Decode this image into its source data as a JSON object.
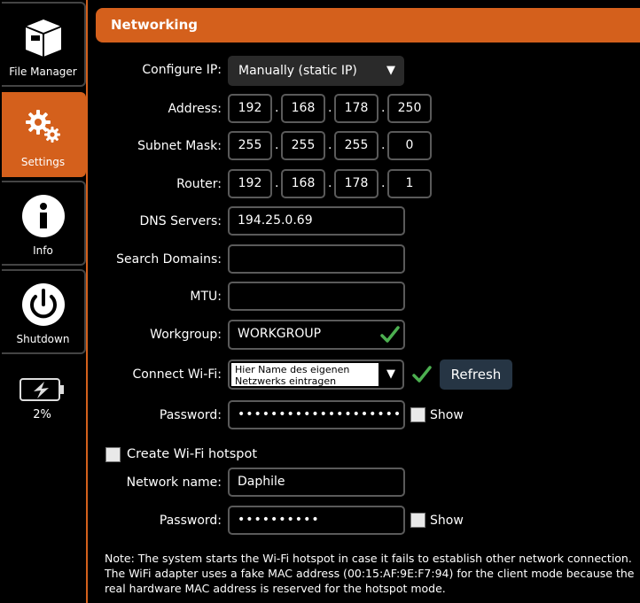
{
  "sidebar": {
    "items": [
      {
        "label": "File Manager",
        "icon": "file-manager-icon",
        "active": false
      },
      {
        "label": "Settings",
        "icon": "gear-icon",
        "active": true
      },
      {
        "label": "Info",
        "icon": "info-icon",
        "active": false
      },
      {
        "label": "Shutdown",
        "icon": "power-icon",
        "active": false
      }
    ],
    "battery": {
      "percent": "2%",
      "icon": "battery-charging-icon"
    }
  },
  "header": {
    "title": "Networking"
  },
  "form": {
    "configure_ip": {
      "label": "Configure IP:",
      "value": "Manually (static IP)"
    },
    "address": {
      "label": "Address:",
      "octets": [
        "192",
        "168",
        "178",
        "250"
      ]
    },
    "subnet_mask": {
      "label": "Subnet Mask:",
      "octets": [
        "255",
        "255",
        "255",
        "0"
      ]
    },
    "router": {
      "label": "Router:",
      "octets": [
        "192",
        "168",
        "178",
        "1"
      ]
    },
    "dns": {
      "label": "DNS Servers:",
      "value": "194.25.0.69"
    },
    "search_domains": {
      "label": "Search Domains:",
      "value": ""
    },
    "mtu": {
      "label": "MTU:",
      "value": ""
    },
    "workgroup": {
      "label": "Workgroup:",
      "value": "WORKGROUP"
    },
    "wifi": {
      "label": "Connect Wi-Fi:",
      "value": "Hier Name des eigenen Netzwerks eintragen",
      "refresh_label": "Refresh"
    },
    "wifi_password": {
      "label": "Password:",
      "value": "••••••••••••••••••••",
      "show_label": "Show"
    },
    "hotspot": {
      "label": "Create Wi-Fi hotspot",
      "checked": false
    },
    "network_name": {
      "label": "Network name:",
      "value": "Daphile"
    },
    "hotspot_password": {
      "label": "Password:",
      "value": "••••••••••",
      "show_label": "Show"
    }
  },
  "note": "Note: The system starts the Wi-Fi hotspot in case it fails to establish other network connection. The WiFi adapter uses a fake MAC address (00:15:AF:9E:F7:94) for the client mode because the real hardware MAC address is reserved for the hotspot mode.",
  "colors": {
    "accent": "#d4601c",
    "check": "#4caf50",
    "refresh_bg": "#263544"
  }
}
